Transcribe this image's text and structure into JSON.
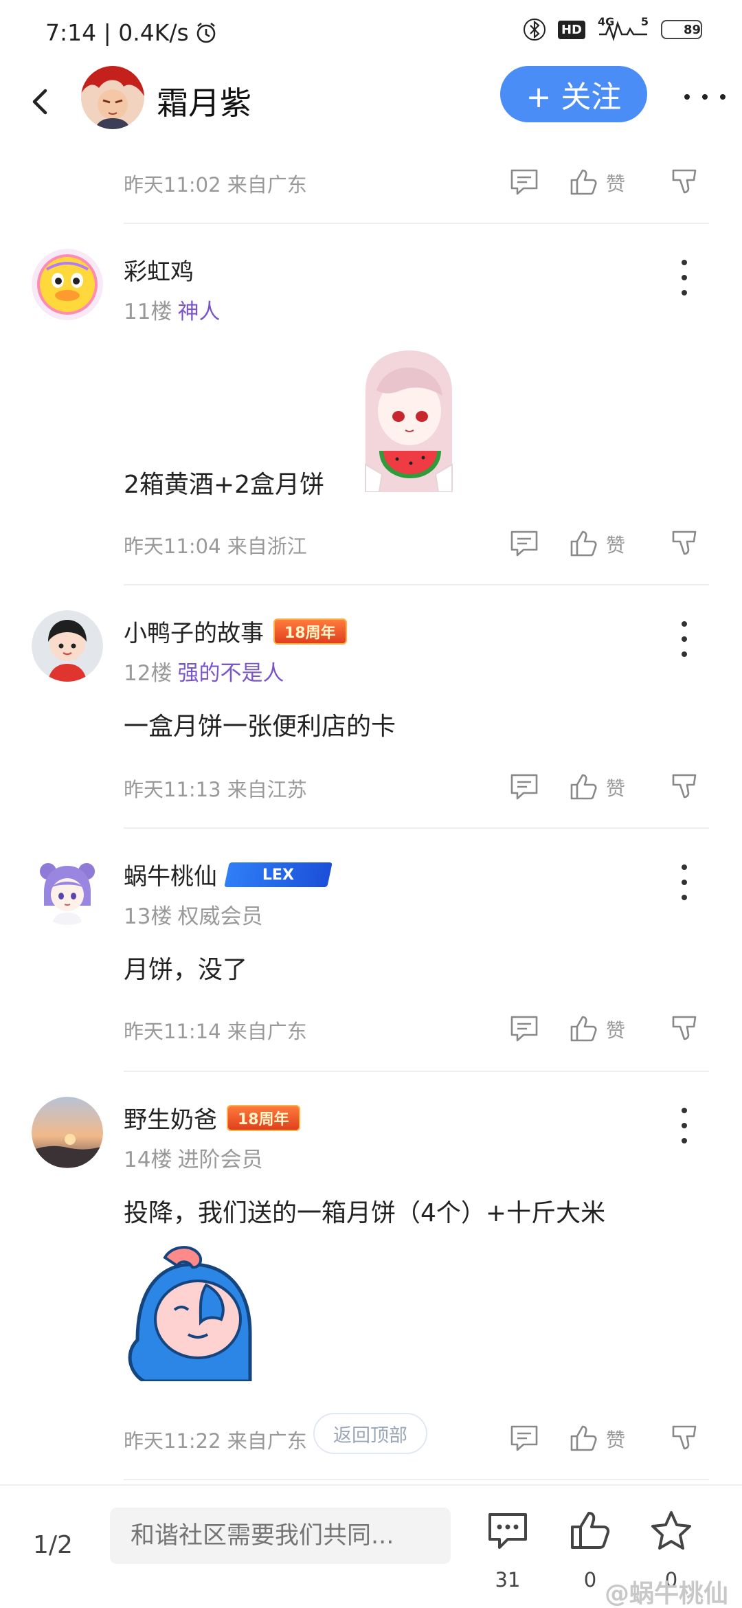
{
  "status_bar": {
    "time_speed": "7:14 | 0.4K/s",
    "network": "4G",
    "signal_extra": "5",
    "battery": "89",
    "battery_level_pct": 89
  },
  "header": {
    "name": "霜月紫",
    "follow_label": "+ 关注"
  },
  "posts": [
    {
      "meta": "昨天11:02 来自广东",
      "like_label": "赞"
    },
    {
      "username": "彩虹鸡",
      "floor": "11楼",
      "title": "神人",
      "title_color": "#7a55c8",
      "content": "2箱黄酒+2盒月饼",
      "meta": "昨天11:04 来自浙江",
      "like_label": "赞"
    },
    {
      "username": "小鸭子的故事",
      "badge": "18周年",
      "floor": "12楼",
      "title": "强的不是人",
      "title_color": "#7a55c8",
      "content": "一盒月饼一张便利店的卡",
      "meta": "昨天11:13 来自江苏",
      "like_label": "赞"
    },
    {
      "username": "蜗牛桃仙",
      "badge": "LEX",
      "floor": "13楼",
      "title": "权威会员",
      "content": "月饼，没了",
      "meta": "昨天11:14 来自广东",
      "like_label": "赞"
    },
    {
      "username": "野生奶爸",
      "badge": "18周年",
      "floor": "14楼",
      "title": "进阶会员",
      "content": "投降，我们送的一箱月饼（4个）+十斤大米",
      "meta": "昨天11:22 来自广东",
      "like_label": "赞"
    }
  ],
  "back_to_top_label": "返回顶部",
  "bottom_bar": {
    "page": "1/2",
    "input_placeholder": "和谐社区需要我们共同...",
    "comment_count": "31",
    "like_count": "0",
    "favorite_count": "0"
  },
  "watermark": "@蜗牛桃仙"
}
